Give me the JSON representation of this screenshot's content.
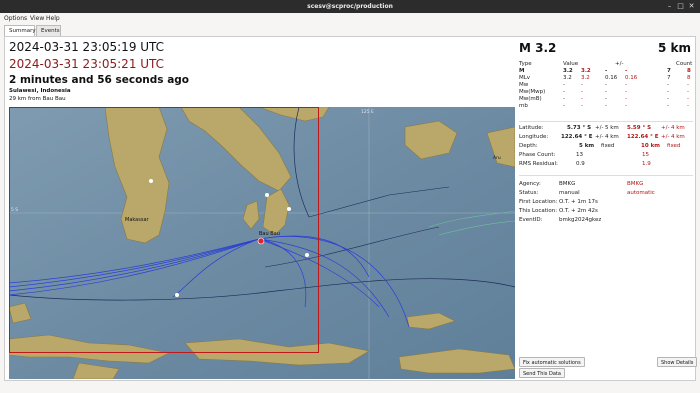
{
  "window": {
    "title": "scesv@scproc/production"
  },
  "menu": {
    "options": "Options",
    "view": "View",
    "help": "Help"
  },
  "tabs": [
    {
      "label": "Summary"
    },
    {
      "label": "Events"
    }
  ],
  "event": {
    "origin_time": "2024-03-31 23:05:19 UTC",
    "update_time": "2024-03-31 23:05:21 UTC",
    "ago": "2 minutes and 56 seconds ago",
    "region": "Sulawesi, Indonesia",
    "nearest_city": "29 km from Bau Bau"
  },
  "map_labels": {
    "city1": "Makassar",
    "city2": "Bau Bau",
    "lat_tick": "5 S",
    "lon_tick": "125 E",
    "place3": "Aru"
  },
  "magnitude": {
    "title": "M 3.2",
    "depth": "5 km"
  },
  "mag_table": {
    "headers": {
      "type": "Type",
      "value": "Value",
      "pm": "+/-",
      "count": "Count"
    },
    "rows": [
      {
        "type": "M",
        "v1": "3.2",
        "v2": "3.2",
        "e1": "-",
        "e2": "-",
        "c1": "7",
        "c2": "8"
      },
      {
        "type": "MLv",
        "v1": "3.2",
        "v2": "3.2",
        "e1": "0.16",
        "e2": "0.16",
        "c1": "7",
        "c2": "8"
      },
      {
        "type": "Mw",
        "v1": "-",
        "v2": "-",
        "e1": "-",
        "e2": "-",
        "c1": "-",
        "c2": "-"
      },
      {
        "type": "Mw(Mwp)",
        "v1": "-",
        "v2": "-",
        "e1": "-",
        "e2": "-",
        "c1": "-",
        "c2": "-"
      },
      {
        "type": "Mw(mB)",
        "v1": "-",
        "v2": "-",
        "e1": "-",
        "e2": "-",
        "c1": "-",
        "c2": "-"
      },
      {
        "type": "mb",
        "v1": "-",
        "v2": "-",
        "e1": "-",
        "e2": "-",
        "c1": "-",
        "c2": "-"
      }
    ]
  },
  "location": {
    "latitude_label": "Latitude:",
    "lat1": "5.73 ° S",
    "lat1_pm": "+/-",
    "lat1_err": "5 km",
    "lat2": "5.59 ° S",
    "lat2_pm": "+/-",
    "lat2_err": "4 km",
    "longitude_label": "Longitude:",
    "lon1": "122.64 ° E",
    "lon1_pm": "+/-",
    "lon1_err": "4 km",
    "lon2": "122.64 ° E",
    "lon2_pm": "+/-",
    "lon2_err": "4 km",
    "depth_label": "Depth:",
    "dep1": "5 km",
    "dep1_st": "fixed",
    "dep2": "10 km",
    "dep2_st": "fixed",
    "phase_label": "Phase Count:",
    "ph1": "13",
    "ph2": "15",
    "rms_label": "RMS Residual:",
    "rms1": "0.9",
    "rms2": "1.9"
  },
  "info": {
    "agency_label": "Agency:",
    "agency1": "BMKG",
    "agency2": "BMKG",
    "status_label": "Status:",
    "status1": "manual",
    "status2": "automatic",
    "first_label": "First Location:",
    "first": "O.T. + 1m 17s",
    "this_label": "This Location:",
    "this": "O.T. + 2m 42s",
    "eventid_label": "EventID:",
    "eventid": "bmkg2024gkez"
  },
  "buttons": {
    "fix": "Fix automatic solutions",
    "show": "Show Details",
    "send": "Send This Data"
  },
  "colors": {
    "accent_red": "#b01515",
    "update_red": "#8b1a1a",
    "sea": "#6f8ea6",
    "land": "#b9a86a"
  }
}
